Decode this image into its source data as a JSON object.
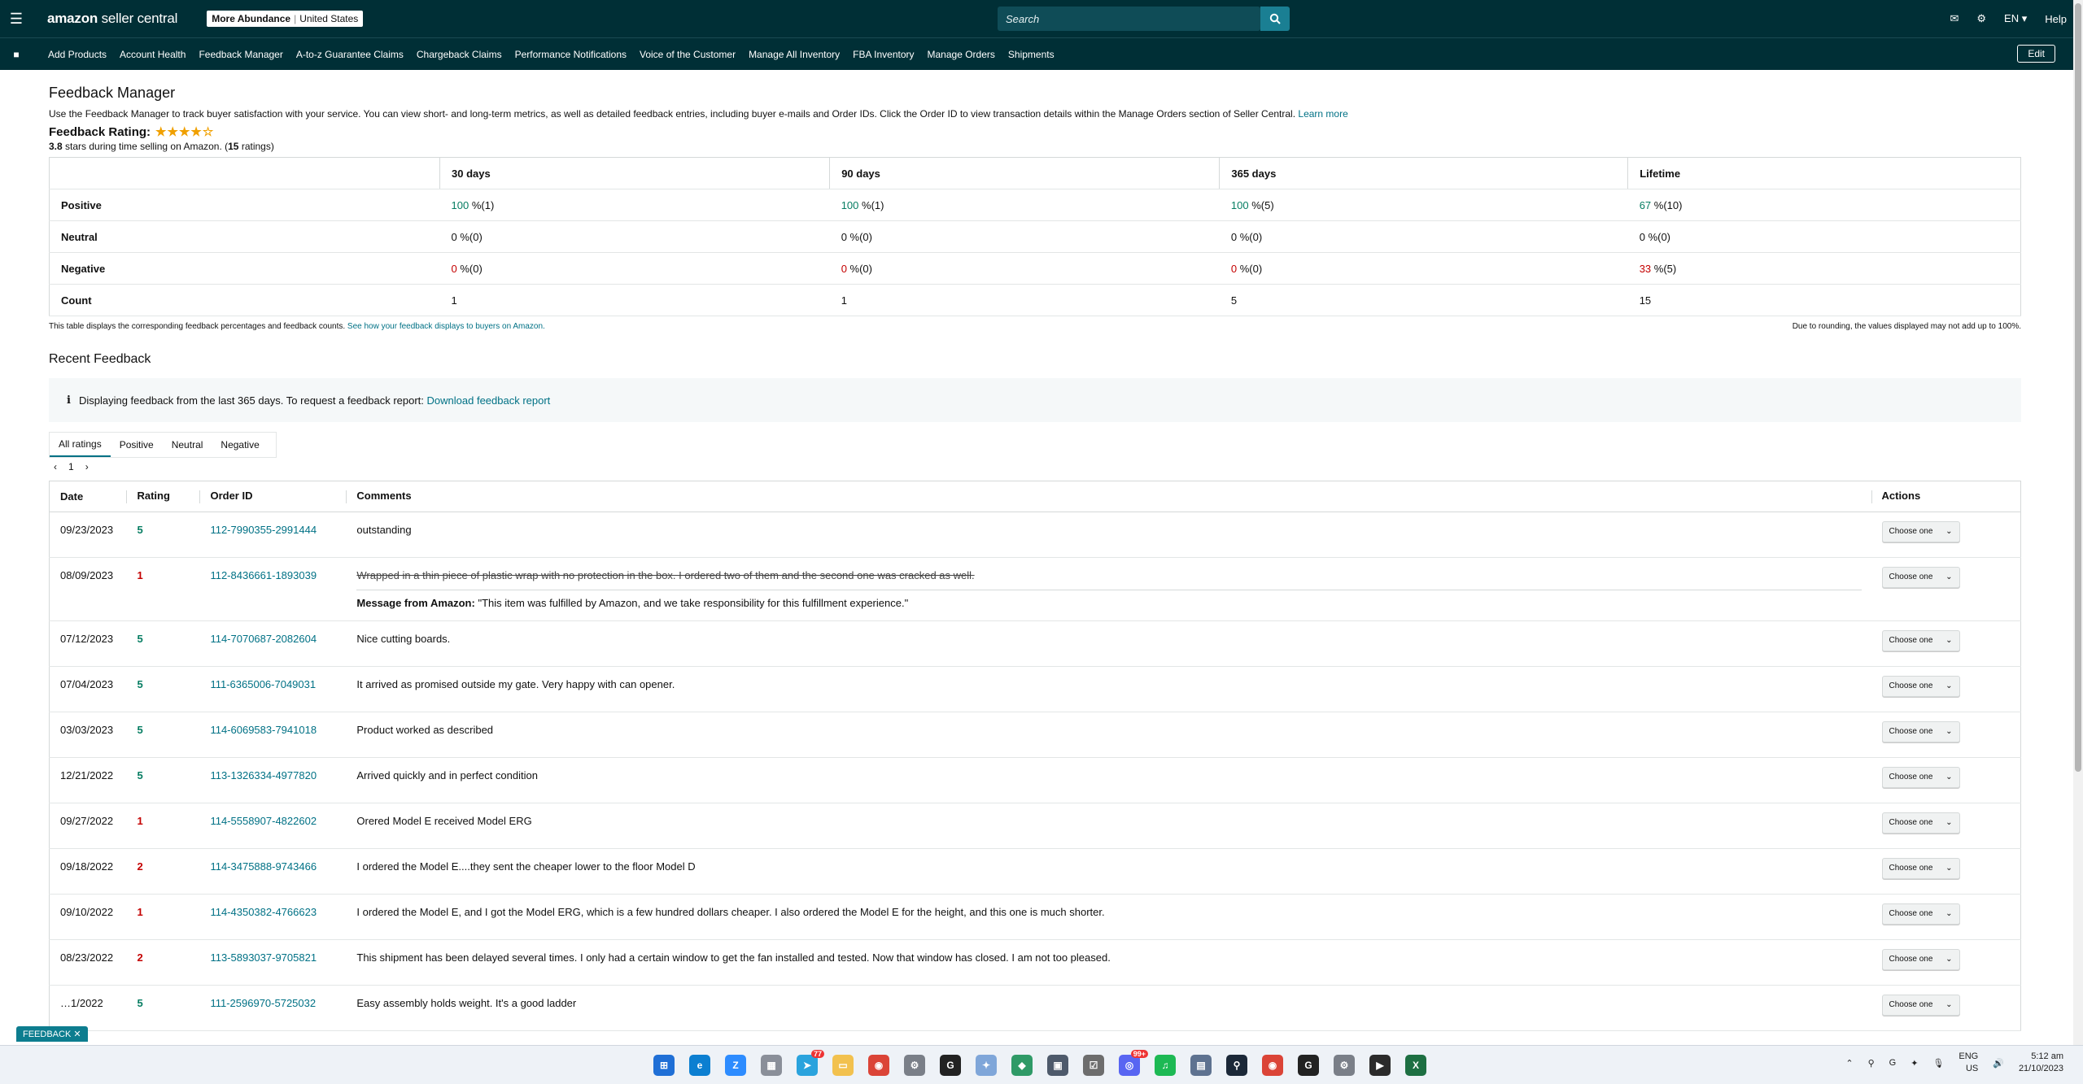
{
  "topbar": {
    "logo_brand": "amazon",
    "logo_suffix": "seller central",
    "store_name": "More Abundance",
    "store_region": "United States",
    "search_placeholder": "Search",
    "language": "EN",
    "help": "Help"
  },
  "nav": {
    "links": [
      "Add Products",
      "Account Health",
      "Feedback Manager",
      "A-to-z Guarantee Claims",
      "Chargeback Claims",
      "Performance Notifications",
      "Voice of the Customer",
      "Manage All Inventory",
      "FBA Inventory",
      "Manage Orders",
      "Shipments"
    ],
    "edit": "Edit"
  },
  "page": {
    "title": "Feedback Manager",
    "intro": "Use the Feedback Manager to track buyer satisfaction with your service. You can view short- and long-term metrics, as well as detailed feedback entries, including buyer e-mails and Order IDs. Click the Order ID to view transaction details within the Manage Orders section of Seller Central.",
    "learn_more": "Learn more",
    "rating_title": "Feedback Rating:",
    "rating_stars": 3.8,
    "rating_value": "3.8",
    "rating_mid": "stars during time selling on Amazon. (",
    "rating_count": "15",
    "rating_end": "ratings)"
  },
  "summary": {
    "columns": [
      "30 days",
      "90 days",
      "365 days",
      "Lifetime"
    ],
    "rows": [
      {
        "label": "Positive",
        "cells": [
          {
            "pct": "100",
            "cnt": "%(1)"
          },
          {
            "pct": "100",
            "cnt": "%(1)"
          },
          {
            "pct": "100",
            "cnt": "%(5)"
          },
          {
            "pct": "67",
            "cnt": "%(10)"
          }
        ]
      },
      {
        "label": "Neutral",
        "cells": [
          {
            "pct": "0",
            "cnt": "%(0)"
          },
          {
            "pct": "0",
            "cnt": "%(0)"
          },
          {
            "pct": "0",
            "cnt": "%(0)"
          },
          {
            "pct": "0",
            "cnt": "%(0)"
          }
        ]
      },
      {
        "label": "Negative",
        "cells": [
          {
            "pct": "0",
            "cnt": "%(0)"
          },
          {
            "pct": "0",
            "cnt": "%(0)"
          },
          {
            "pct": "0",
            "cnt": "%(0)"
          },
          {
            "pct": "33",
            "cnt": "%(5)"
          }
        ]
      },
      {
        "label": "Count",
        "cells": [
          {
            "pct": "1",
            "cnt": ""
          },
          {
            "pct": "1",
            "cnt": ""
          },
          {
            "pct": "5",
            "cnt": ""
          },
          {
            "pct": "15",
            "cnt": ""
          }
        ]
      }
    ],
    "note_left": "This table displays the corresponding feedback percentages and feedback counts.",
    "note_link": "See how your feedback displays to buyers on Amazon.",
    "note_right": "Due to rounding, the values displayed may not add up to 100%."
  },
  "recent": {
    "title": "Recent Feedback",
    "info": "Displaying feedback from the last 365 days. To request a feedback report:",
    "info_link": "Download feedback report",
    "tabs": [
      "All ratings",
      "Positive",
      "Neutral",
      "Negative"
    ],
    "page": "1",
    "headers": [
      "Date",
      "Rating",
      "Order ID",
      "Comments",
      "Actions"
    ],
    "choose_label": "Choose one",
    "rows": [
      {
        "date": "09/23/2023",
        "rating": "5",
        "order": "112-7990355-2991444",
        "comment": "outstanding",
        "struck": false,
        "msg_label": "",
        "msg": ""
      },
      {
        "date": "08/09/2023",
        "rating": "1",
        "order": "112-8436661-1893039",
        "comment": "Wrapped in a thin piece of plastic wrap with no protection in the box. I ordered two of them and the second one was cracked as well.",
        "struck": true,
        "msg_label": "Message from Amazon:",
        "msg": "\"This item was fulfilled by Amazon, and we take responsibility for this fulfillment experience.\""
      },
      {
        "date": "07/12/2023",
        "rating": "5",
        "order": "114-7070687-2082604",
        "comment": "Nice cutting boards.",
        "struck": false,
        "msg_label": "",
        "msg": ""
      },
      {
        "date": "07/04/2023",
        "rating": "5",
        "order": "111-6365006-7049031",
        "comment": "It arrived as promised outside my gate. Very happy with can opener.",
        "struck": false,
        "msg_label": "",
        "msg": ""
      },
      {
        "date": "03/03/2023",
        "rating": "5",
        "order": "114-6069583-7941018",
        "comment": "Product worked as described",
        "struck": false,
        "msg_label": "",
        "msg": ""
      },
      {
        "date": "12/21/2022",
        "rating": "5",
        "order": "113-1326334-4977820",
        "comment": "Arrived quickly and in perfect condition",
        "struck": false,
        "msg_label": "",
        "msg": ""
      },
      {
        "date": "09/27/2022",
        "rating": "1",
        "order": "114-5558907-4822602",
        "comment": "Orered Model E received Model ERG",
        "struck": false,
        "msg_label": "",
        "msg": ""
      },
      {
        "date": "09/18/2022",
        "rating": "2",
        "order": "114-3475888-9743466",
        "comment": "I ordered the Model E....they sent the cheaper lower to the floor Model D",
        "struck": false,
        "msg_label": "",
        "msg": ""
      },
      {
        "date": "09/10/2022",
        "rating": "1",
        "order": "114-4350382-4766623",
        "comment": "I ordered the Model E, and I got the Model ERG, which is a few hundred dollars cheaper. I also ordered the Model E for the height, and this one is much shorter.",
        "struck": false,
        "msg_label": "",
        "msg": ""
      },
      {
        "date": "08/23/2022",
        "rating": "2",
        "order": "113-5893037-9705821",
        "comment": "This shipment has been delayed several times. I only had a certain window to get the fan installed and tested. Now that window has closed. I am not too pleased.",
        "struck": false,
        "msg_label": "",
        "msg": ""
      },
      {
        "date": "…1/2022",
        "rating": "5",
        "order": "111-2596970-5725032",
        "comment": "Easy assembly holds weight. It's a good ladder",
        "struck": false,
        "msg_label": "",
        "msg": ""
      }
    ]
  },
  "feedback_tab": "FEEDBACK",
  "taskbar": {
    "lang_top": "ENG",
    "lang_bottom": "US",
    "time": "5:12 am",
    "date": "21/10/2023",
    "telegram_badge": "77",
    "discord_badge": "99+"
  },
  "colors": {
    "topbar": "#002f36",
    "link": "#007185",
    "positive": "#067d62",
    "negative": "#c40000"
  }
}
